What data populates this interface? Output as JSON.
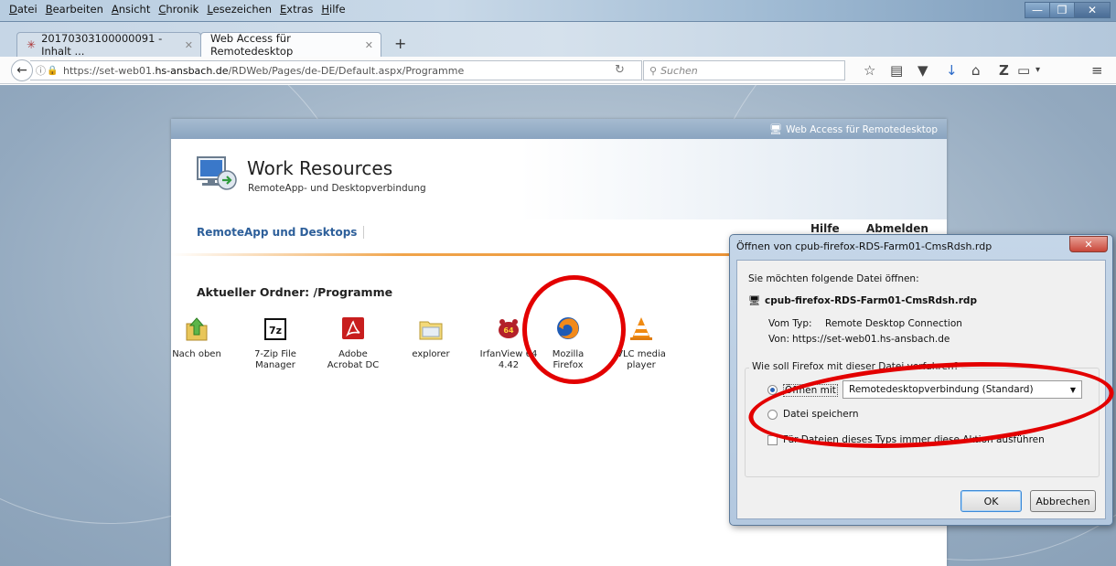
{
  "window": {
    "menu": [
      "Datei",
      "Bearbeiten",
      "Ansicht",
      "Chronik",
      "Lesezeichen",
      "Extras",
      "Hilfe"
    ]
  },
  "tabs": [
    {
      "label": "20170303100000091 - Inhalt ..."
    },
    {
      "label": "Web Access für Remotedesktop"
    }
  ],
  "nav": {
    "url_prefix": "https://set-web01.",
    "url_domain": "hs-ansbach.de",
    "url_path": "/RDWeb/Pages/de-DE/Default.aspx/Programme",
    "search_placeholder": "Suchen"
  },
  "rdweb": {
    "header_link": "Web Access für Remotedesktop",
    "title": "Work Resources",
    "subtitle": "RemoteApp- und Desktopverbindung",
    "nav_label": "RemoteApp und Desktops",
    "help": "Hilfe",
    "logout": "Abmelden",
    "folder": "Aktueller Ordner: /Programme",
    "apps": [
      {
        "line1": "Nach oben",
        "line2": ""
      },
      {
        "line1": "7-Zip File",
        "line2": "Manager"
      },
      {
        "line1": "Adobe",
        "line2": "Acrobat DC"
      },
      {
        "line1": "explorer",
        "line2": ""
      },
      {
        "line1": "IrfanView 64",
        "line2": "4.42"
      },
      {
        "line1": "Mozilla",
        "line2": "Firefox"
      },
      {
        "line1": "VLC media",
        "line2": "player"
      }
    ]
  },
  "dialog": {
    "title": "Öffnen von cpub-firefox-RDS-Farm01-CmsRdsh.rdp",
    "prompt": "Sie möchten folgende Datei öffnen:",
    "filename": "cpub-firefox-RDS-Farm01-CmsRdsh.rdp",
    "type_label": "Vom Typ:",
    "type_value": "Remote Desktop Connection",
    "from_label": "Von:",
    "from_value": "https://set-web01.hs-ansbach.de",
    "group_label": "Wie soll Firefox mit dieser Datei verfahren?",
    "open_with_label": "Öffnen mit",
    "open_with_value": "Remotedesktopverbindung (Standard)",
    "save_label": "Datei speichern",
    "always_label": "Für Dateien dieses Typs immer diese Aktion ausführen",
    "ok": "OK",
    "cancel": "Abbrechen"
  },
  "colors": {
    "accent": "#e30000",
    "link_blue": "#2d5f9a"
  }
}
